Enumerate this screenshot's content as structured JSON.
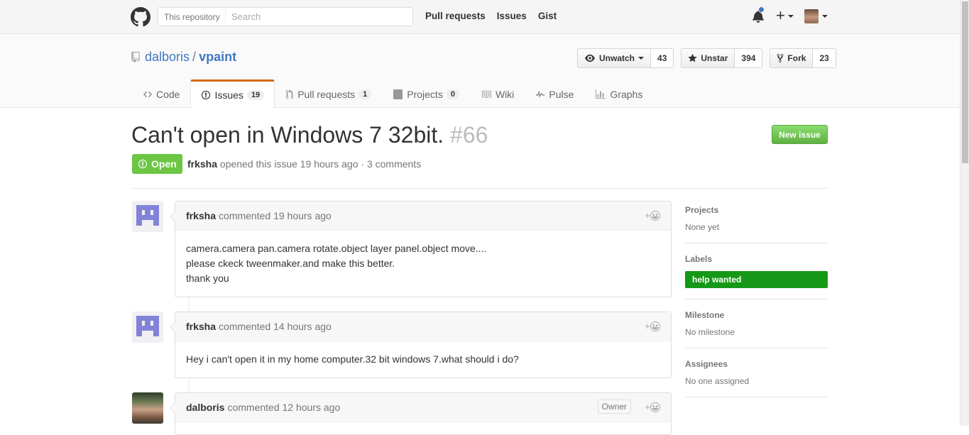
{
  "header": {
    "search_scope": "This repository",
    "search_placeholder": "Search",
    "nav": [
      "Pull requests",
      "Issues",
      "Gist"
    ]
  },
  "repo": {
    "owner": "dalboris",
    "separator": "/",
    "name": "vpaint",
    "unwatch_label": "Unwatch",
    "watch_count": "43",
    "unstar_label": "Unstar",
    "star_count": "394",
    "fork_label": "Fork",
    "fork_count": "23",
    "tabs": [
      {
        "label": "Code",
        "counter": null,
        "selected": false
      },
      {
        "label": "Issues",
        "counter": "19",
        "selected": true
      },
      {
        "label": "Pull requests",
        "counter": "1",
        "selected": false
      },
      {
        "label": "Projects",
        "counter": "0",
        "selected": false
      },
      {
        "label": "Wiki",
        "counter": null,
        "selected": false
      },
      {
        "label": "Pulse",
        "counter": null,
        "selected": false
      },
      {
        "label": "Graphs",
        "counter": null,
        "selected": false
      }
    ]
  },
  "issue": {
    "title": "Can't open in Windows 7 32bit.",
    "number": "#66",
    "new_issue_label": "New issue",
    "state": "Open",
    "author": "frksha",
    "opened_text": "opened this issue 19 hours ago · 3 comments"
  },
  "comments": [
    {
      "author": "frksha",
      "action": "commented 19 hours ago",
      "body": [
        "camera.camera pan.camera rotate.object layer panel.object move....",
        "please ckeck tweenmaker.and make this better.",
        "thank you"
      ],
      "owner": null
    },
    {
      "author": "frksha",
      "action": "commented 14 hours ago",
      "body": [
        "Hey i can't open it in my home computer.32 bit windows 7.what should i do?"
      ],
      "owner": null
    },
    {
      "author": "dalboris",
      "action": "commented 12 hours ago",
      "body": [],
      "owner": "Owner"
    }
  ],
  "reaction_plus": "+",
  "sidebar": {
    "projects_heading": "Projects",
    "projects_value": "None yet",
    "labels_heading": "Labels",
    "label": "help wanted",
    "label_color": "#159818",
    "milestone_heading": "Milestone",
    "milestone_value": "No milestone",
    "assignees_heading": "Assignees",
    "assignees_value": "No one assigned"
  }
}
